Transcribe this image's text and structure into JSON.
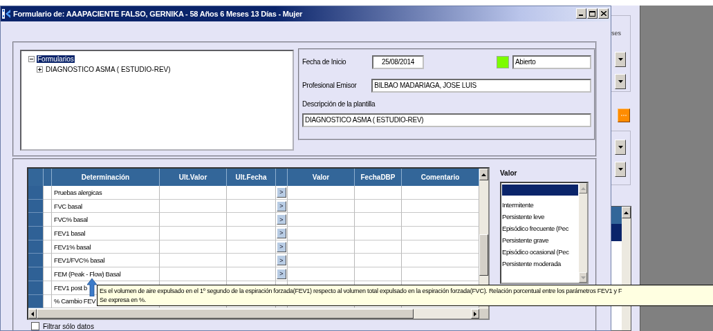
{
  "window": {
    "title": "Formulario de: AAAPACIENTE FALSO, GERNIKA - 58 Años 6 Meses 13 Días - Mujer"
  },
  "tree": {
    "nodes": [
      {
        "label": "Formularios",
        "selected": true,
        "expanded": true,
        "children": [
          {
            "label": "DIAGNOSTICO ASMA  ( ESTUDIO-REV)",
            "selected": false,
            "expanded": false
          }
        ]
      }
    ]
  },
  "header_form": {
    "start_date_label": "Fecha de Inicio",
    "start_date": "25/08/2014",
    "status": "Abierto",
    "issuer_label": "Profesional Emisor",
    "issuer": "BILBAO MADARIAGA, JOSE LUIS",
    "template_label": "Descripción de la plantilla",
    "template": "DIAGNOSTICO ASMA  ( ESTUDIO-REV)"
  },
  "grid": {
    "columns": [
      {
        "label": "Determinación"
      },
      {
        "label": "Ult.Valor"
      },
      {
        "label": "Ult.Fecha"
      },
      {
        "label": "Valor"
      },
      {
        "label": "FechaDBP"
      },
      {
        "label": "Comentario"
      }
    ],
    "rows": [
      {
        "label": "Pruebas alergicas",
        "button": ">"
      },
      {
        "label": "FVC basal",
        "button": ">"
      },
      {
        "label": "FVC% basal",
        "button": ">"
      },
      {
        "label": "FEV1 basal",
        "button": ">"
      },
      {
        "label": "FEV1% basal",
        "button": ">"
      },
      {
        "label": "FEV1/FVC% basal",
        "button": ">"
      },
      {
        "label": "FEM (Peak - Flow) Basal",
        "button": ">"
      },
      {
        "label": "FEV1 post b"
      },
      {
        "label": "% Cambio FEV"
      }
    ]
  },
  "filter": {
    "label": "Filtrar sólo datos",
    "checked": false
  },
  "value_list": {
    "title": "Valor",
    "blank_selected": true,
    "items": [
      {
        "label": "Intermitente",
        "selected": false
      },
      {
        "label": "Persistente leve",
        "selected": false
      },
      {
        "label": "Episódico frecuente (Pec",
        "selected": false
      },
      {
        "label": "Persistente grave",
        "selected": false
      },
      {
        "label": "Episódico ocasional (Pec",
        "selected": false
      },
      {
        "label": "Persistente moderada",
        "selected": false
      }
    ]
  },
  "tooltip": {
    "lines": [
      "Es el volumen de aire expulsado en el 1º segundo de la espiración forzada(FEV1) respecto al volumen total expulsado en la espiración forzada(FVC). Relación porcentual entre los parámetros FEV1 y F",
      "Se expresa en %."
    ]
  },
  "back_window": {
    "label": "ses"
  }
}
